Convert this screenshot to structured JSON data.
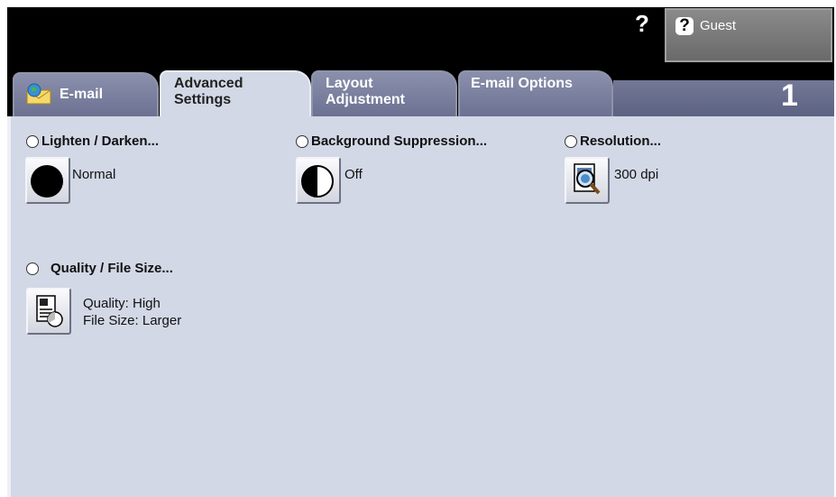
{
  "header": {
    "help_glyph": "?",
    "user_button": {
      "help_glyph": "?",
      "label": "Guest"
    }
  },
  "tabs": {
    "email": {
      "label": "E-mail"
    },
    "advanced": {
      "line1": "Advanced",
      "line2": "Settings"
    },
    "layout": {
      "line1": "Layout",
      "line2": "Adjustment"
    },
    "email_options": {
      "label": "E-mail Options"
    }
  },
  "copy_count": "1",
  "options": {
    "lighten_darken": {
      "title": "Lighten / Darken...",
      "value": "Normal"
    },
    "background_suppression": {
      "title": "Background Suppression...",
      "value": "Off"
    },
    "resolution": {
      "title": "Resolution...",
      "value": "300 dpi"
    },
    "quality_file_size": {
      "title": "Quality / File Size...",
      "value_line1": "Quality: High",
      "value_line2": "File Size: Larger"
    }
  },
  "icons": {
    "email_tab": "envelope-globe-icon",
    "lighten": "dark-circle-icon",
    "background": "half-circle-icon",
    "resolution": "magnifier-document-icon",
    "quality": "document-quality-icon"
  }
}
